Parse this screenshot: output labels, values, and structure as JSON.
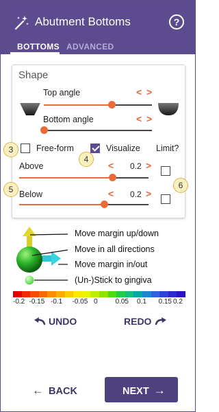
{
  "header": {
    "title": "Abutment Bottoms",
    "help_label": "?",
    "wand_icon": "magic-wand-icon",
    "color": "#5c4b8f"
  },
  "tabs": [
    {
      "label": "BOTTOMS",
      "active": true
    },
    {
      "label": "ADVANCED",
      "active": false
    }
  ],
  "shape": {
    "title": "Shape",
    "top_angle": {
      "label": "Top angle",
      "prev": "<",
      "next": ">",
      "level": 0.63
    },
    "bottom_angle": {
      "label": "Bottom angle",
      "prev": "<",
      "next": ">",
      "level": 0.0
    },
    "free_form": {
      "label": "Free-form",
      "checked": false
    },
    "visualize": {
      "label": "Visualize",
      "checked": true
    },
    "limit_label": "Limit?",
    "above": {
      "label": "Above",
      "prev": "<",
      "next": ">",
      "value": "0.2",
      "level": 0.72,
      "limit_checked": false
    },
    "below": {
      "label": "Below",
      "prev": "<",
      "next": ">",
      "value": "0.2",
      "level": 0.66,
      "limit_checked": false
    }
  },
  "badges": [
    "3",
    "4",
    "5",
    "6"
  ],
  "legend": {
    "move_up_down": "Move margin up/down",
    "move_all": "Move in all directions",
    "move_in_out": "Move margin in/out",
    "stick": "(Un-)Stick to gingiva"
  },
  "colorbar": {
    "colors": [
      "#e00000",
      "#ef2a00",
      "#f34b00",
      "#f56b00",
      "#f88d00",
      "#f9ad00",
      "#fbcc00",
      "#fde800",
      "#e9f500",
      "#bfee00",
      "#8ee400",
      "#4fdb14",
      "#22cd4c",
      "#16c07c",
      "#0aa7a9",
      "#1d85cf",
      "#2d62dc",
      "#2f43d8",
      "#2c28cf",
      "#2a12c2"
    ],
    "ticks": [
      "-0.2",
      "-0.15",
      "-0.1",
      "-0.05",
      "0",
      "0.05",
      "0.1",
      "0.15",
      "0.2"
    ]
  },
  "actions": {
    "undo": "UNDO",
    "redo": "REDO",
    "back": "BACK",
    "next": "NEXT"
  }
}
